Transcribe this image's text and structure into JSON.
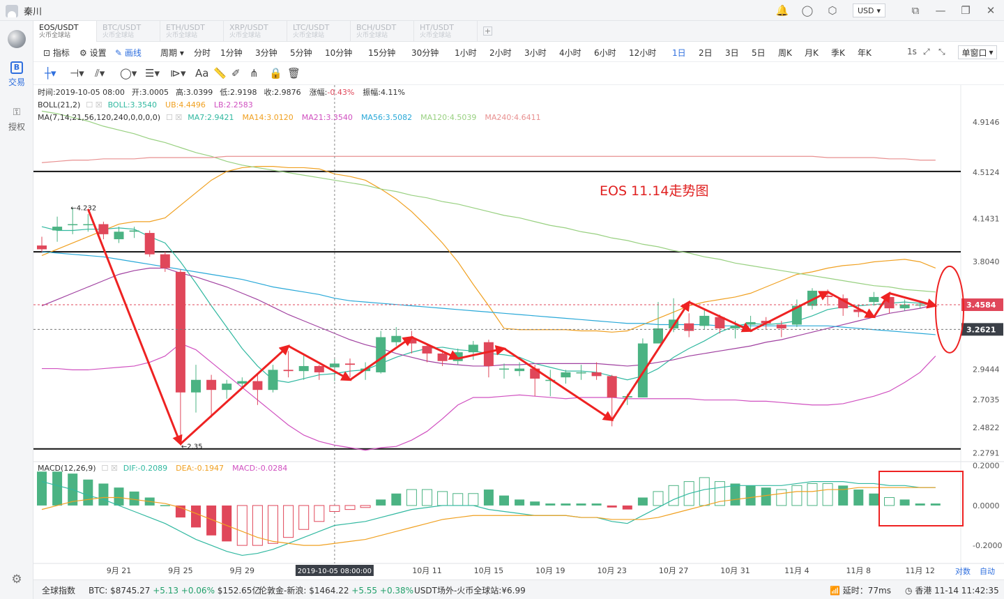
{
  "window": {
    "user": "秦川",
    "currency": "USD"
  },
  "tabs": [
    {
      "pair": "EOS/USDT",
      "source": "火币全球站"
    },
    {
      "pair": "BTC/USDT",
      "source": "火币全球站"
    },
    {
      "pair": "ETH/USDT",
      "source": "火币全球站"
    },
    {
      "pair": "XRP/USDT",
      "source": "火币全球站"
    },
    {
      "pair": "LTC/USDT",
      "source": "火币全球站"
    },
    {
      "pair": "BCH/USDT",
      "source": "火币全球站"
    },
    {
      "pair": "HT/USDT",
      "source": "火币全球站"
    }
  ],
  "sidebar": {
    "trade": "交易",
    "auth": "授权"
  },
  "toolbar": {
    "indicator": "指标",
    "settings": "设置",
    "draw": "画线",
    "period_label": "周期",
    "periods": [
      "分时",
      "1分钟",
      "3分钟",
      "5分钟",
      "10分钟",
      "15分钟",
      "30分钟",
      "1小时",
      "2小时",
      "3小时",
      "4小时",
      "6小时",
      "12小时",
      "1日",
      "2日",
      "3日",
      "5日",
      "周K",
      "月K",
      "季K",
      "年K"
    ],
    "active_period": "1日",
    "speed": "1s",
    "window_mode": "单窗口"
  },
  "info": {
    "time_label": "时间:2019-10-05 08:00",
    "open": "开:3.0005",
    "high": "高:3.0399",
    "low": "低:2.9198",
    "close": "收:2.9876",
    "change": "-0.43%",
    "change_label": "涨幅:",
    "amplitude": "振幅:4.11%",
    "boll": "BOLL(21,2)",
    "boll_val": "BOLL:3.3540",
    "ub": "UB:4.4496",
    "lb": "LB:2.2583",
    "ma": "MA(7,14,21,56,120,240,0,0,0,0)",
    "ma7": "MA7:2.9421",
    "ma14": "MA14:3.0120",
    "ma21": "MA21:3.3540",
    "ma56": "MA56:3.5082",
    "ma120": "MA120:4.5039",
    "ma240": "MA240:4.6411",
    "macd": "MACD(12,26,9)",
    "dif": "DIF:-0.2089",
    "dea": "DEA:-0.1947",
    "macd_val": "MACD:-0.0284"
  },
  "chart_data": {
    "type": "candlestick",
    "title": "EOS 11.14走势图",
    "y_ticks": [
      "4.9146",
      "4.5124",
      "4.1431",
      "3.8040",
      "3.4584",
      "3.2621",
      "2.9444",
      "2.7035",
      "2.4822",
      "2.2791"
    ],
    "y_range": [
      2.22,
      5.03
    ],
    "macd_ticks": [
      "0.2000",
      "0.0000",
      "-0.2000"
    ],
    "macd_range": [
      -0.28,
      0.22
    ],
    "x_labels": [
      "9月 21",
      "9月 25",
      "9月 29",
      "2019-10-05 08:00:00",
      "10月 11",
      "10月 15",
      "10月 19",
      "10月 23",
      "10月 27",
      "10月 31",
      "11月 4",
      "11月 8",
      "11月 12"
    ],
    "x_label_index": [
      5,
      9,
      13,
      19,
      25,
      29,
      33,
      37,
      41,
      45,
      49,
      53,
      57
    ],
    "last_price": "3.4584",
    "cursor_price": "3.2621",
    "max_label": "4.232",
    "min_label": "2.35",
    "horizontal_lines": [
      4.52,
      3.88,
      2.31
    ],
    "candles": [
      [
        3.93,
        3.9,
        4.0,
        3.88
      ],
      [
        4.05,
        4.08,
        4.16,
        3.96
      ],
      [
        4.1,
        4.1,
        4.23,
        4.02
      ],
      [
        4.1,
        4.1,
        4.18,
        4.04
      ],
      [
        4.1,
        4.02,
        4.12,
        3.98
      ],
      [
        3.98,
        4.04,
        4.08,
        3.95
      ],
      [
        4.04,
        4.05,
        4.08,
        3.99
      ],
      [
        4.03,
        3.86,
        4.05,
        3.84
      ],
      [
        3.86,
        3.75,
        3.88,
        3.72
      ],
      [
        3.72,
        2.76,
        3.74,
        2.35
      ],
      [
        2.76,
        2.86,
        2.98,
        2.6
      ],
      [
        2.86,
        2.78,
        2.9,
        2.56
      ],
      [
        2.78,
        2.83,
        2.86,
        2.71
      ],
      [
        2.83,
        2.85,
        2.88,
        2.79
      ],
      [
        2.85,
        2.78,
        2.9,
        2.66
      ],
      [
        2.78,
        2.94,
        2.98,
        2.76
      ],
      [
        2.94,
        2.93,
        3.09,
        2.88
      ],
      [
        2.93,
        2.97,
        3.06,
        2.86
      ],
      [
        2.97,
        2.92,
        2.98,
        2.86
      ],
      [
        2.96,
        2.99,
        3.03,
        2.85
      ],
      [
        2.99,
        2.98,
        3.03,
        2.88
      ],
      [
        2.93,
        2.95,
        3.0,
        2.86
      ],
      [
        2.92,
        3.2,
        3.25,
        2.91
      ],
      [
        3.16,
        3.21,
        3.28,
        3.13
      ],
      [
        3.19,
        3.15,
        3.25,
        3.07
      ],
      [
        3.13,
        3.07,
        3.14,
        3.0
      ],
      [
        3.07,
        3.01,
        3.1,
        2.97
      ],
      [
        3.01,
        3.08,
        3.11,
        2.98
      ],
      [
        3.08,
        3.14,
        3.17,
        3.02
      ],
      [
        3.16,
        2.97,
        3.18,
        2.88
      ],
      [
        2.95,
        2.95,
        2.99,
        2.87
      ],
      [
        2.93,
        2.95,
        3.0,
        2.89
      ],
      [
        2.95,
        2.87,
        2.98,
        2.73
      ],
      [
        2.86,
        2.86,
        2.94,
        2.73
      ],
      [
        2.88,
        2.92,
        2.94,
        2.83
      ],
      [
        2.92,
        2.92,
        2.98,
        2.86
      ],
      [
        2.92,
        2.89,
        3.0,
        2.86
      ],
      [
        2.89,
        2.72,
        2.9,
        2.49
      ],
      [
        2.72,
        2.73,
        2.75,
        2.66
      ],
      [
        2.72,
        3.15,
        3.19,
        2.72
      ],
      [
        3.15,
        3.27,
        3.48,
        3.15
      ],
      [
        3.27,
        3.34,
        3.51,
        3.24
      ],
      [
        3.31,
        3.25,
        3.39,
        3.2
      ],
      [
        3.29,
        3.37,
        3.43,
        3.26
      ],
      [
        3.36,
        3.27,
        3.38,
        3.23
      ],
      [
        3.27,
        3.29,
        3.33,
        3.19
      ],
      [
        3.3,
        3.32,
        3.37,
        3.24
      ],
      [
        3.33,
        3.31,
        3.36,
        3.26
      ],
      [
        3.3,
        3.27,
        3.33,
        3.2
      ],
      [
        3.3,
        3.45,
        3.5,
        3.28
      ],
      [
        3.45,
        3.57,
        3.59,
        3.42
      ],
      [
        3.53,
        3.52,
        3.58,
        3.45
      ],
      [
        3.51,
        3.43,
        3.54,
        3.37
      ],
      [
        3.42,
        3.4,
        3.46,
        3.36
      ],
      [
        3.48,
        3.52,
        3.56,
        3.45
      ],
      [
        3.52,
        3.43,
        3.54,
        3.39
      ],
      [
        3.43,
        3.46,
        3.5,
        3.41
      ],
      [
        3.46,
        3.46,
        3.48,
        3.43
      ]
    ],
    "macd_hist": [
      0.17,
      0.17,
      0.16,
      0.13,
      0.11,
      0.09,
      0.07,
      0.04,
      0.002,
      -0.06,
      -0.11,
      -0.15,
      -0.18,
      -0.2,
      -0.2,
      -0.19,
      -0.16,
      -0.12,
      -0.08,
      -0.03,
      -0.02,
      -0.01,
      0.03,
      0.06,
      0.08,
      0.08,
      0.07,
      0.06,
      0.06,
      0.08,
      0.05,
      0.03,
      0.02,
      0.01,
      0.01,
      0.01,
      0.01,
      -0.01,
      -0.02,
      0.04,
      0.07,
      0.1,
      0.12,
      0.14,
      0.12,
      0.11,
      0.1,
      0.09,
      0.08,
      0.1,
      0.11,
      0.11,
      0.1,
      0.08,
      0.06,
      0.04,
      0.03,
      0.01,
      0.01
    ],
    "dif": [
      0.12,
      0.1,
      0.08,
      0.05,
      0.03,
      0.0,
      -0.03,
      -0.06,
      -0.09,
      -0.13,
      -0.17,
      -0.2,
      -0.23,
      -0.25,
      -0.24,
      -0.22,
      -0.19,
      -0.16,
      -0.13,
      -0.1,
      -0.09,
      -0.08,
      -0.06,
      -0.04,
      -0.02,
      -0.01,
      0.0,
      0.0,
      0.0,
      -0.02,
      -0.03,
      -0.04,
      -0.05,
      -0.05,
      -0.05,
      -0.06,
      -0.06,
      -0.08,
      -0.09,
      -0.05,
      -0.01,
      0.03,
      0.06,
      0.08,
      0.09,
      0.1,
      0.1,
      0.1,
      0.1,
      0.11,
      0.12,
      0.12,
      0.12,
      0.11,
      0.11,
      0.1,
      0.1,
      0.09,
      0.09
    ],
    "dea": [
      -0.02,
      0.0,
      0.02,
      0.03,
      0.04,
      0.04,
      0.03,
      0.02,
      0.01,
      -0.01,
      -0.04,
      -0.07,
      -0.1,
      -0.13,
      -0.16,
      -0.18,
      -0.19,
      -0.2,
      -0.2,
      -0.19,
      -0.18,
      -0.17,
      -0.15,
      -0.13,
      -0.11,
      -0.09,
      -0.07,
      -0.06,
      -0.05,
      -0.05,
      -0.05,
      -0.05,
      -0.05,
      -0.05,
      -0.05,
      -0.06,
      -0.06,
      -0.07,
      -0.07,
      -0.07,
      -0.06,
      -0.04,
      -0.02,
      0.0,
      0.02,
      0.03,
      0.04,
      0.05,
      0.06,
      0.07,
      0.07,
      0.08,
      0.08,
      0.09,
      0.09,
      0.09,
      0.09,
      0.09,
      0.09
    ],
    "ma_series": [
      {
        "name": "UB",
        "color": "#f0a020",
        "values": [
          3.85,
          3.9,
          3.95,
          4.0,
          4.05,
          4.1,
          4.12,
          4.12,
          4.15,
          4.25,
          4.35,
          4.45,
          4.52,
          4.55,
          4.56,
          4.56,
          4.55,
          4.55,
          4.54,
          4.5,
          4.48,
          4.45,
          4.38,
          4.3,
          4.2,
          4.08,
          3.95,
          3.8,
          3.62,
          3.45,
          3.27,
          3.26,
          3.26,
          3.26,
          3.26,
          3.25,
          3.25,
          3.24,
          3.25,
          3.3,
          3.35,
          3.4,
          3.45,
          3.48,
          3.5,
          3.52,
          3.55,
          3.6,
          3.65,
          3.7,
          3.72,
          3.75,
          3.77,
          3.78,
          3.8,
          3.81,
          3.82,
          3.8,
          3.75
        ]
      },
      {
        "name": "LB",
        "color": "#d050c0",
        "values": [
          2.95,
          2.95,
          2.94,
          2.94,
          2.95,
          2.96,
          2.97,
          3.0,
          3.05,
          3.15,
          3.1,
          3.0,
          2.9,
          2.8,
          2.7,
          2.6,
          2.5,
          2.42,
          2.37,
          2.34,
          2.32,
          2.3,
          2.32,
          2.33,
          2.38,
          2.45,
          2.55,
          2.66,
          2.72,
          2.72,
          2.73,
          2.74,
          2.73,
          2.72,
          2.71,
          2.72,
          2.72,
          2.72,
          2.71,
          2.71,
          2.71,
          2.71,
          2.71,
          2.7,
          2.7,
          2.7,
          2.69,
          2.69,
          2.68,
          2.67,
          2.66,
          2.66,
          2.67,
          2.7,
          2.73,
          2.77,
          2.84,
          2.92,
          3.05
        ]
      },
      {
        "name": "MA7",
        "color": "#30b8a0",
        "values": [
          4.08,
          4.05,
          4.05,
          4.06,
          4.06,
          4.07,
          4.06,
          4.0,
          3.95,
          3.8,
          3.63,
          3.45,
          3.28,
          3.11,
          2.97,
          2.86,
          2.84,
          2.87,
          2.9,
          2.91,
          2.93,
          2.94,
          2.99,
          3.04,
          3.08,
          3.11,
          3.12,
          3.1,
          3.09,
          3.07,
          3.06,
          3.04,
          2.99,
          2.96,
          2.93,
          2.93,
          2.92,
          2.89,
          2.86,
          2.89,
          2.95,
          3.04,
          3.11,
          3.17,
          3.24,
          3.29,
          3.31,
          3.3,
          3.31,
          3.33,
          3.37,
          3.42,
          3.44,
          3.45,
          3.46,
          3.47,
          3.48,
          3.47,
          3.46
        ]
      },
      {
        "name": "MA21",
        "color": "#a040a0",
        "values": [
          3.45,
          3.5,
          3.55,
          3.6,
          3.65,
          3.7,
          3.73,
          3.75,
          3.75,
          3.71,
          3.68,
          3.64,
          3.6,
          3.55,
          3.5,
          3.44,
          3.38,
          3.33,
          3.28,
          3.23,
          3.18,
          3.14,
          3.11,
          3.07,
          3.04,
          3.01,
          2.99,
          2.98,
          2.97,
          2.97,
          2.98,
          2.98,
          2.99,
          2.99,
          2.99,
          2.99,
          2.99,
          2.98,
          2.97,
          2.98,
          3.0,
          3.02,
          3.05,
          3.07,
          3.09,
          3.11,
          3.13,
          3.16,
          3.18,
          3.21,
          3.24,
          3.27,
          3.3,
          3.33,
          3.36,
          3.39,
          3.41,
          3.43,
          3.46
        ]
      },
      {
        "name": "MA56",
        "color": "#28a8d8",
        "values": [
          3.88,
          3.87,
          3.86,
          3.85,
          3.84,
          3.82,
          3.8,
          3.78,
          3.76,
          3.74,
          3.72,
          3.7,
          3.68,
          3.66,
          3.63,
          3.6,
          3.58,
          3.56,
          3.54,
          3.51,
          3.49,
          3.48,
          3.47,
          3.46,
          3.45,
          3.44,
          3.43,
          3.42,
          3.41,
          3.4,
          3.39,
          3.38,
          3.37,
          3.36,
          3.35,
          3.34,
          3.33,
          3.32,
          3.31,
          3.31,
          3.3,
          3.3,
          3.3,
          3.3,
          3.29,
          3.29,
          3.29,
          3.29,
          3.29,
          3.29,
          3.29,
          3.29,
          3.28,
          3.27,
          3.26,
          3.25,
          3.24,
          3.23,
          3.22
        ]
      },
      {
        "name": "MA120",
        "color": "#98d080",
        "values": [
          5.0,
          4.98,
          4.95,
          4.92,
          4.88,
          4.85,
          4.82,
          4.78,
          4.75,
          4.71,
          4.67,
          4.64,
          4.6,
          4.57,
          4.55,
          4.53,
          4.51,
          4.49,
          4.47,
          4.45,
          4.43,
          4.41,
          4.38,
          4.36,
          4.33,
          4.31,
          4.28,
          4.26,
          4.23,
          4.2,
          4.17,
          4.15,
          4.12,
          4.09,
          4.07,
          4.04,
          4.02,
          3.99,
          3.97,
          3.94,
          3.92,
          3.89,
          3.87,
          3.84,
          3.82,
          3.79,
          3.77,
          3.75,
          3.73,
          3.71,
          3.69,
          3.67,
          3.65,
          3.63,
          3.61,
          3.6,
          3.58,
          3.57,
          3.56
        ]
      },
      {
        "name": "MA240",
        "color": "#e89090",
        "values": [
          4.59,
          4.6,
          4.61,
          4.61,
          4.62,
          4.62,
          4.62,
          4.63,
          4.63,
          4.63,
          4.63,
          4.63,
          4.64,
          4.64,
          4.64,
          4.64,
          4.64,
          4.64,
          4.64,
          4.64,
          4.64,
          4.64,
          4.64,
          4.64,
          4.64,
          4.64,
          4.64,
          4.64,
          4.64,
          4.64,
          4.64,
          4.64,
          4.64,
          4.64,
          4.64,
          4.64,
          4.64,
          4.64,
          4.64,
          4.64,
          4.64,
          4.64,
          4.64,
          4.64,
          4.64,
          4.64,
          4.64,
          4.64,
          4.64,
          4.64,
          4.64,
          4.63,
          4.63,
          4.63,
          4.63,
          4.62,
          4.62,
          4.61,
          4.61
        ]
      }
    ],
    "trend_arrows": [
      [
        3,
        4.22
      ],
      [
        9,
        2.35
      ],
      [
        16,
        3.13
      ],
      [
        20,
        2.86
      ],
      [
        24,
        3.2
      ],
      [
        27,
        3.03
      ],
      [
        30,
        3.11
      ],
      [
        37,
        2.54
      ],
      [
        42,
        3.48
      ],
      [
        46,
        3.25
      ],
      [
        51,
        3.56
      ],
      [
        54,
        3.36
      ],
      [
        55,
        3.55
      ],
      [
        58,
        3.45
      ]
    ],
    "colors": {
      "up": "#4bb383",
      "down": "#e0475a",
      "arrow": "#ee2222"
    }
  },
  "footer": {
    "index": "全球指数",
    "btc_label": "BTC:",
    "btc_price": "$8745.27",
    "btc_change": "+5.13 +0.06%",
    "btc_vol": "$152.65亿",
    "gold_label": "伦敦金-新浪:",
    "gold_price": "$1464.22",
    "gold_change": "+5.55 +0.38%",
    "usdt_label": "USDT场外-火币全球站:",
    "usdt_price": "¥6.99",
    "latency": "延时：77ms",
    "clock": "香港 11-14 11:42:35",
    "axis_log": "对数",
    "axis_auto": "自动"
  }
}
